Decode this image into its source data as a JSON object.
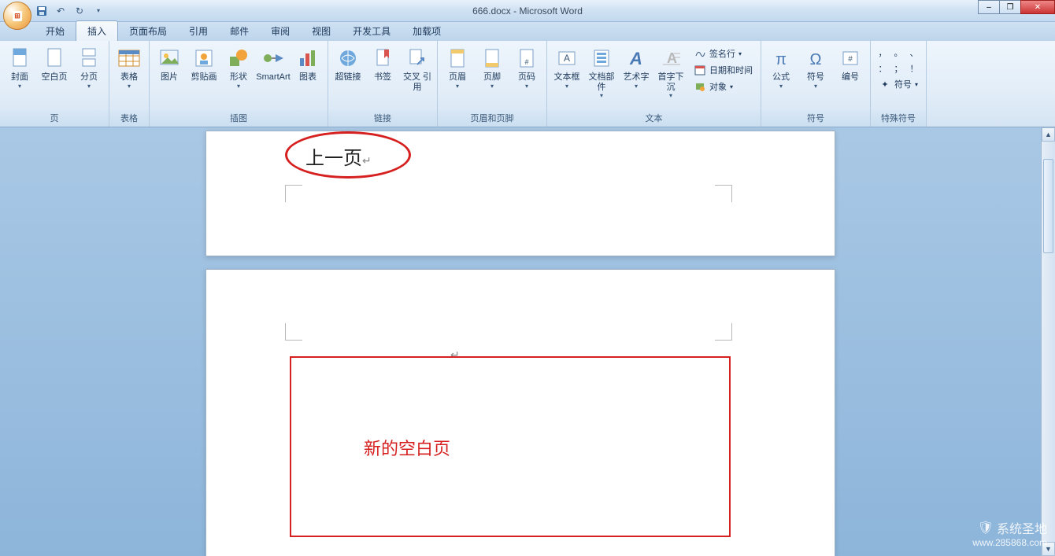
{
  "app": {
    "title": "666.docx - Microsoft Word"
  },
  "qat": {
    "save": "保存",
    "undo": "撤销",
    "redo": "重做"
  },
  "tabs": [
    "开始",
    "插入",
    "页面布局",
    "引用",
    "邮件",
    "审阅",
    "视图",
    "开发工具",
    "加载项"
  ],
  "active_tab_index": 1,
  "ribbon": {
    "groups": [
      {
        "name": "页",
        "items": [
          {
            "id": "cover",
            "label": "封面",
            "drop": true
          },
          {
            "id": "blank",
            "label": "空白页"
          },
          {
            "id": "pagebreak",
            "label": "分页",
            "drop": true
          }
        ]
      },
      {
        "name": "表格",
        "items": [
          {
            "id": "table",
            "label": "表格",
            "drop": true
          }
        ]
      },
      {
        "name": "插图",
        "items": [
          {
            "id": "picture",
            "label": "图片"
          },
          {
            "id": "clipart",
            "label": "剪贴画"
          },
          {
            "id": "shapes",
            "label": "形状",
            "drop": true
          },
          {
            "id": "smartart",
            "label": "SmartArt"
          },
          {
            "id": "chart",
            "label": "图表"
          }
        ]
      },
      {
        "name": "链接",
        "items": [
          {
            "id": "hyperlink",
            "label": "超链接"
          },
          {
            "id": "bookmark",
            "label": "书签"
          },
          {
            "id": "crossref",
            "label": "交叉\n引用"
          }
        ]
      },
      {
        "name": "页眉和页脚",
        "items": [
          {
            "id": "header",
            "label": "页眉",
            "drop": true
          },
          {
            "id": "footer",
            "label": "页脚",
            "drop": true
          },
          {
            "id": "pagenum",
            "label": "页码",
            "drop": true
          }
        ]
      },
      {
        "name": "文本",
        "items": [
          {
            "id": "textbox",
            "label": "文本框",
            "drop": true
          },
          {
            "id": "quickparts",
            "label": "文档部件",
            "drop": true
          },
          {
            "id": "wordart",
            "label": "艺术字",
            "drop": true
          },
          {
            "id": "dropcap",
            "label": "首字下沉",
            "drop": true
          }
        ],
        "small": [
          {
            "id": "signature",
            "label": "签名行",
            "drop": true
          },
          {
            "id": "datetime",
            "label": "日期和时间"
          },
          {
            "id": "object",
            "label": "对象",
            "drop": true
          }
        ]
      },
      {
        "name": "符号",
        "items": [
          {
            "id": "equation",
            "label": "公式",
            "drop": true
          },
          {
            "id": "symbol",
            "label": "符号",
            "drop": true
          },
          {
            "id": "number",
            "label": "编号"
          }
        ]
      },
      {
        "name": "特殊符号",
        "small": [
          {
            "id": "comma",
            "label": "，"
          },
          {
            "id": "period",
            "label": "。"
          },
          {
            "id": "sep",
            "label": "、"
          },
          {
            "id": "colon",
            "label": "："
          },
          {
            "id": "semi",
            "label": "；"
          },
          {
            "id": "excl",
            "label": "！"
          },
          {
            "id": "more",
            "label": "符号",
            "drop": true
          }
        ]
      }
    ]
  },
  "document": {
    "page1_text": "上一页",
    "page2_text": "新的空白页",
    "page2_color": "#d62020"
  },
  "watermark": {
    "brand": "系统圣地",
    "url": "www.285868.com"
  },
  "window": {
    "minimize": "–",
    "maximize": "❐",
    "close": "✕"
  }
}
